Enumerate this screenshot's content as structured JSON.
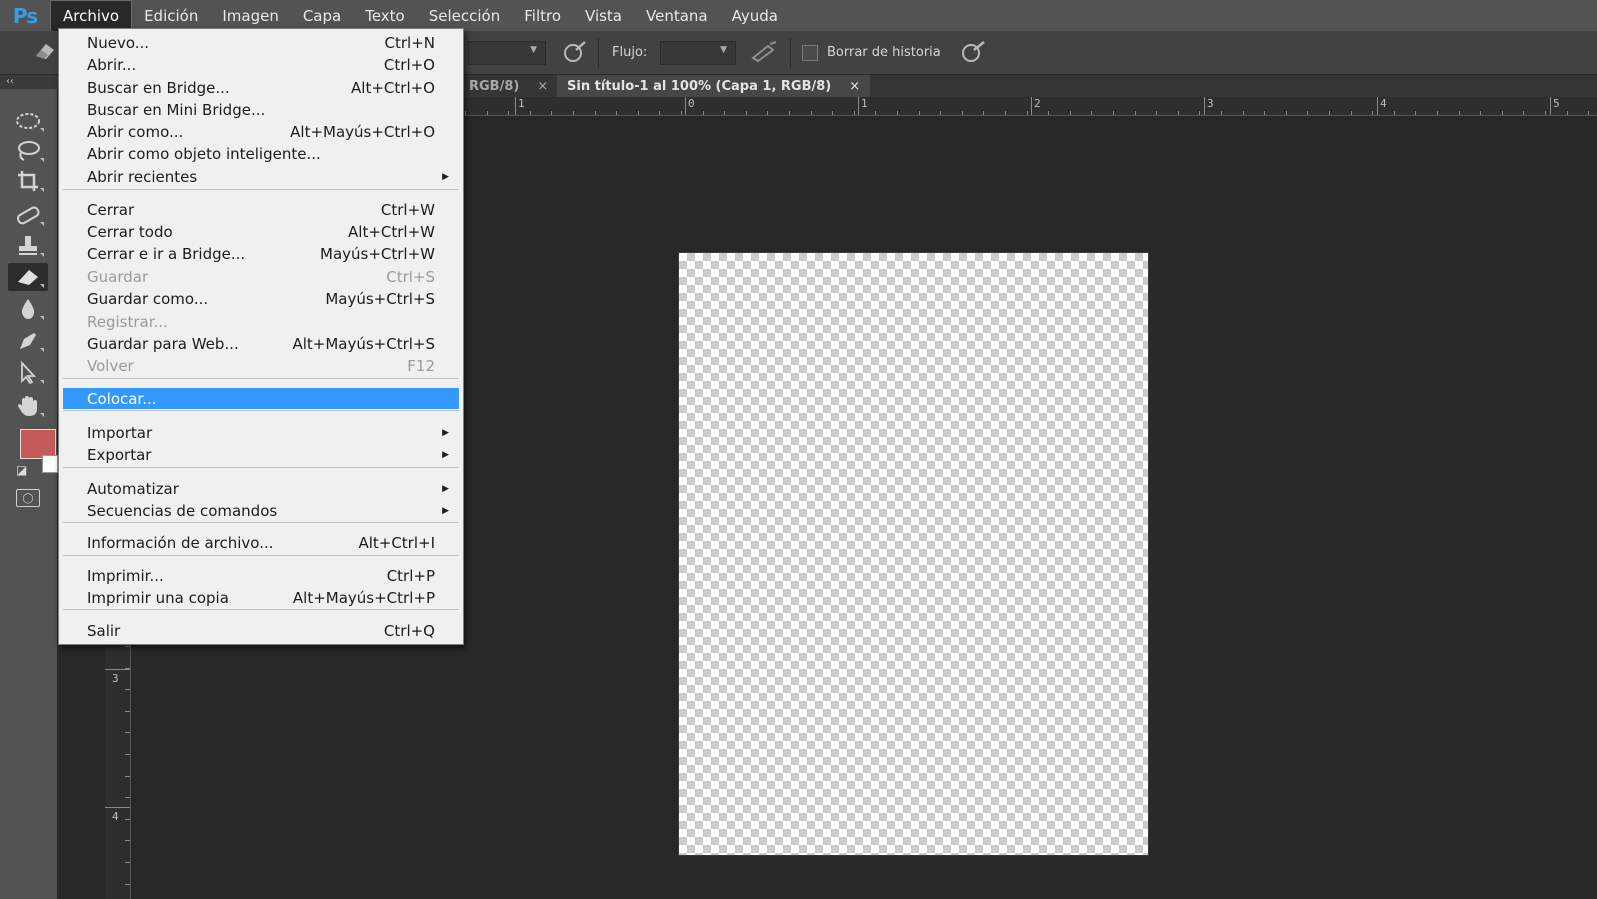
{
  "app": {
    "logo": "Ps"
  },
  "menubar": {
    "items": [
      "Archivo",
      "Edición",
      "Imagen",
      "Capa",
      "Texto",
      "Selección",
      "Filtro",
      "Vista",
      "Ventana",
      "Ayuda"
    ],
    "active": "Archivo"
  },
  "options": {
    "flow_label": "Flujo:",
    "erase_history_label": "Borrar de historia",
    "erase_history_checked": false
  },
  "tabs": [
    {
      "label": "RGB/8)",
      "close": "×",
      "active": false
    },
    {
      "label": "Sin título-1 al 100% (Capa 1, RGB/8)",
      "close": "×",
      "active": true
    }
  ],
  "rulers": {
    "horizontal": [
      "1",
      "0",
      "1",
      "2",
      "3",
      "4",
      "5"
    ],
    "vertical": [
      "3",
      "4"
    ]
  },
  "tools": {
    "collapse_glyph": "‹‹",
    "foreground_color": "#c45a5a",
    "background_color": "#ffffff",
    "items": [
      "rectangular-marquee",
      "lasso",
      "crop",
      "spot-healing-brush",
      "clone-stamp",
      "eraser",
      "blur",
      "pen",
      "path-selection",
      "hand"
    ],
    "active": "eraser"
  },
  "file_menu": {
    "items": [
      {
        "label": "Nuevo...",
        "shortcut": "Ctrl+N"
      },
      {
        "label": "Abrir...",
        "shortcut": "Ctrl+O"
      },
      {
        "label": "Buscar en Bridge...",
        "shortcut": "Alt+Ctrl+O"
      },
      {
        "label": "Buscar en Mini Bridge...",
        "shortcut": ""
      },
      {
        "label": "Abrir como...",
        "shortcut": "Alt+Mayús+Ctrl+O"
      },
      {
        "label": "Abrir como objeto inteligente...",
        "shortcut": ""
      },
      {
        "label": "Abrir recientes",
        "shortcut": "",
        "submenu": true
      },
      {
        "label": "Cerrar",
        "shortcut": "Ctrl+W"
      },
      {
        "label": "Cerrar todo",
        "shortcut": "Alt+Ctrl+W"
      },
      {
        "label": "Cerrar e ir a Bridge...",
        "shortcut": "Mayús+Ctrl+W"
      },
      {
        "label": "Guardar",
        "shortcut": "Ctrl+S",
        "disabled": true
      },
      {
        "label": "Guardar como...",
        "shortcut": "Mayús+Ctrl+S"
      },
      {
        "label": "Registrar...",
        "shortcut": "",
        "disabled": true
      },
      {
        "label": "Guardar para Web...",
        "shortcut": "Alt+Mayús+Ctrl+S"
      },
      {
        "label": "Volver",
        "shortcut": "F12",
        "disabled": true
      },
      {
        "label": "Colocar...",
        "shortcut": "",
        "selected": true
      },
      {
        "label": "Importar",
        "shortcut": "",
        "submenu": true
      },
      {
        "label": "Exportar",
        "shortcut": "",
        "submenu": true
      },
      {
        "label": "Automatizar",
        "shortcut": "",
        "submenu": true
      },
      {
        "label": "Secuencias de comandos",
        "shortcut": "",
        "submenu": true
      },
      {
        "label": "Información de archivo...",
        "shortcut": "Alt+Ctrl+I"
      },
      {
        "label": "Imprimir...",
        "shortcut": "Ctrl+P"
      },
      {
        "label": "Imprimir una copia",
        "shortcut": "Alt+Mayús+Ctrl+P"
      },
      {
        "label": "Salir",
        "shortcut": "Ctrl+Q"
      }
    ]
  },
  "colors": {
    "accent_selected": "#3399ff",
    "menu_bg": "#f0f0f0",
    "app_bg": "#282828"
  }
}
